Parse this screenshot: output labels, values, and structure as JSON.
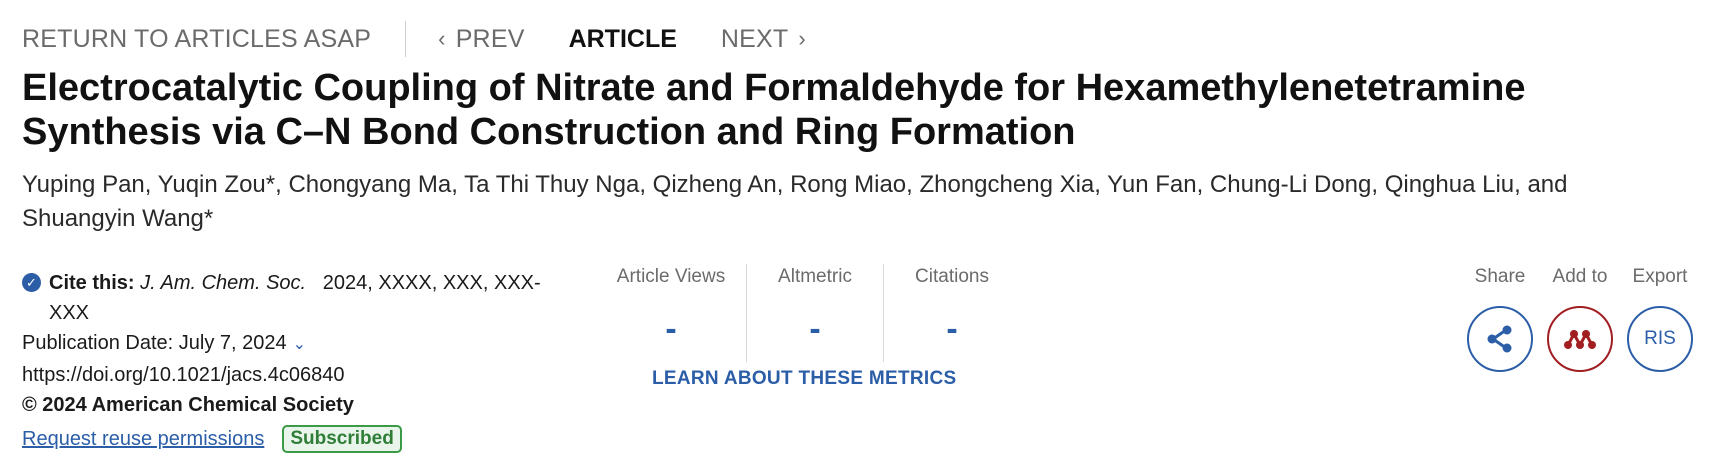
{
  "nav": {
    "return_label": "RETURN TO ARTICLES ASAP",
    "prev_label": "PREV",
    "article_label": "ARTICLE",
    "next_label": "NEXT"
  },
  "article": {
    "title": "Electrocatalytic Coupling of Nitrate and Formaldehyde for Hexamethylenetetramine Synthesis via C–N Bond Construction and Ring Formation",
    "authors": "Yuping Pan, Yuqin Zou*, Chongyang Ma, Ta Thi Thuy Nga, Qizheng An, Rong Miao, Zhongcheng Xia, Yun Fan, Chung-Li Dong, Qinghua Liu, and Shuangyin Wang*",
    "cite_label": "Cite this:",
    "journal": "J. Am. Chem. Soc.",
    "cite_details": "2024, XXXX, XXX, XXX-XXX",
    "publication_date": "Publication Date: July 7, 2024",
    "doi": "https://doi.org/10.1021/jacs.4c06840",
    "copyright": "© 2024 American Chemical Society",
    "reuse_link": "Request reuse permissions",
    "subscribed_badge": "Subscribed"
  },
  "metrics": {
    "views_label": "Article Views",
    "views_value": "-",
    "altmetric_label": "Altmetric",
    "altmetric_value": "-",
    "citations_label": "Citations",
    "citations_value": "-",
    "learn_link": "LEARN ABOUT THESE METRICS"
  },
  "actions": {
    "share_label": "Share",
    "add_label": "Add to",
    "export_label": "Export",
    "export_button": "RIS"
  },
  "colors": {
    "link_blue": "#2b5ea7",
    "mendeley_red": "#a11e22",
    "subscribed_green": "#3a9a45"
  }
}
